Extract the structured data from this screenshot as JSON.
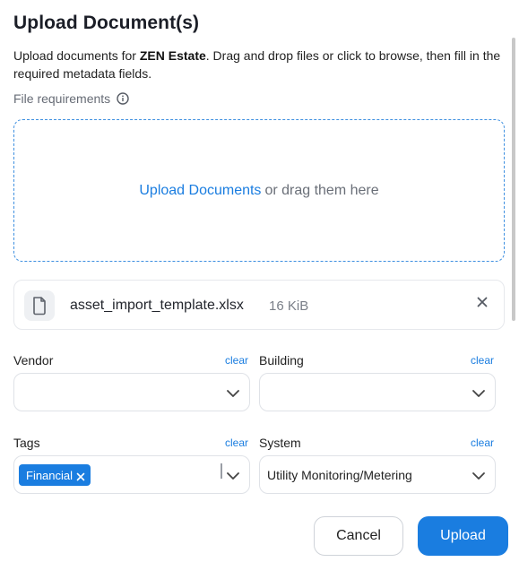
{
  "dialog": {
    "title": "Upload Document(s)",
    "desc_prefix": "Upload documents for ",
    "desc_entity": "ZEN Estate",
    "desc_suffix": ". Drag and drop files or click to browse, then fill in the required metadata fields.",
    "requirements_label": "File requirements"
  },
  "dropzone": {
    "link_text": "Upload Documents",
    "rest_text": "or drag them here"
  },
  "file": {
    "name": "asset_import_template.xlsx",
    "size": "16 KiB"
  },
  "fields": {
    "vendor": {
      "label": "Vendor",
      "clear": "clear",
      "value": ""
    },
    "building": {
      "label": "Building",
      "clear": "clear",
      "value": ""
    },
    "tags": {
      "label": "Tags",
      "clear": "clear",
      "chips": [
        "Financial"
      ]
    },
    "system": {
      "label": "System",
      "clear": "clear",
      "value": "Utility Monitoring/Metering"
    }
  },
  "actions": {
    "cancel": "Cancel",
    "upload": "Upload"
  },
  "colors": {
    "accent": "#1a7de0",
    "border": "#dfe2e7"
  }
}
